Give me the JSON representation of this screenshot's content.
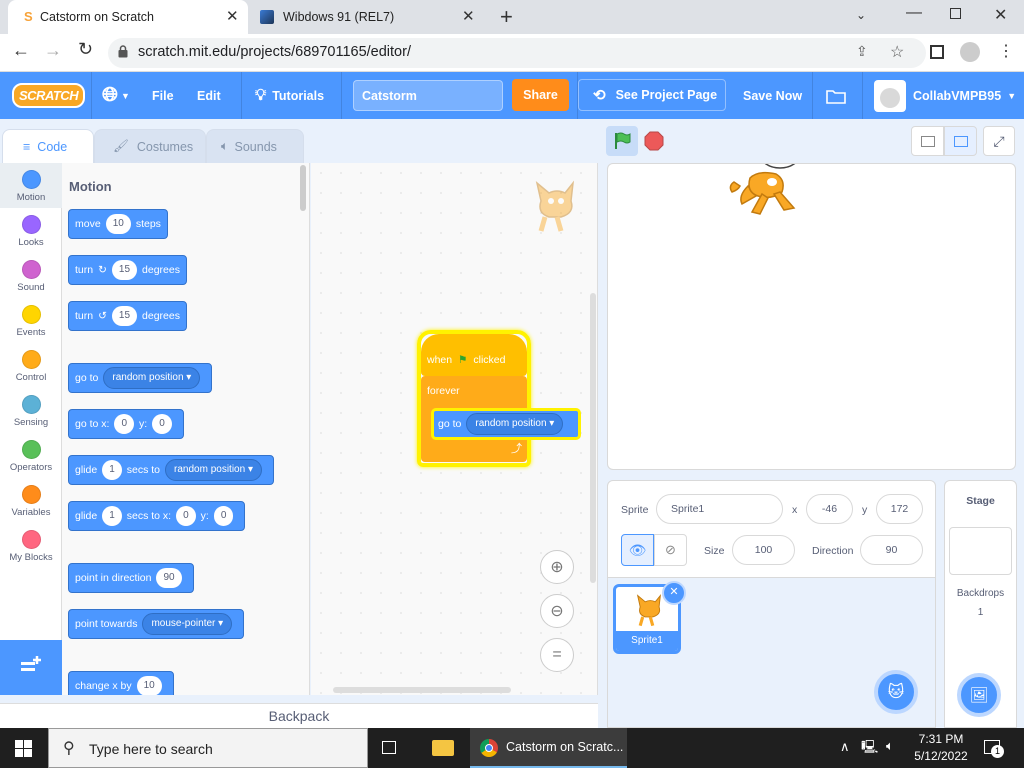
{
  "browser": {
    "tabs": [
      {
        "title": "Catstorm on Scratch",
        "active": true
      },
      {
        "title": "Wibdows 91 (REL7)",
        "active": false
      }
    ],
    "url": "scratch.mit.edu/projects/689701165/editor/"
  },
  "menubar": {
    "logo": "SCRATCH",
    "file": "File",
    "edit": "Edit",
    "tutorials": "Tutorials",
    "project_title": "Catstorm",
    "share": "Share",
    "see_project_page": "See Project Page",
    "save_now": "Save Now",
    "username": "CollabVMPB95"
  },
  "editor_tabs": {
    "code": "Code",
    "costumes": "Costumes",
    "sounds": "Sounds"
  },
  "categories": [
    {
      "label": "Motion",
      "color": "#4c97ff"
    },
    {
      "label": "Looks",
      "color": "#9966ff"
    },
    {
      "label": "Sound",
      "color": "#cf63cf"
    },
    {
      "label": "Events",
      "color": "#ffd500"
    },
    {
      "label": "Control",
      "color": "#ffab19"
    },
    {
      "label": "Sensing",
      "color": "#5cb1d6"
    },
    {
      "label": "Operators",
      "color": "#59c059"
    },
    {
      "label": "Variables",
      "color": "#ff8c1a"
    },
    {
      "label": "My Blocks",
      "color": "#ff6680"
    }
  ],
  "palette": {
    "heading": "Motion",
    "move": {
      "a": "move",
      "v": "10",
      "b": "steps"
    },
    "turn_right": {
      "a": "turn",
      "v": "15",
      "b": "degrees"
    },
    "turn_left": {
      "a": "turn",
      "v": "15",
      "b": "degrees"
    },
    "go_to": {
      "a": "go to",
      "dd": "random position"
    },
    "go_to_xy": {
      "a": "go to x:",
      "x": "0",
      "b": "y:",
      "y": "0"
    },
    "glide_to": {
      "a": "glide",
      "v": "1",
      "b": "secs to",
      "dd": "random position"
    },
    "glide_xy": {
      "a": "glide",
      "v": "1",
      "b": "secs to x:",
      "x": "0",
      "c": "y:",
      "y": "0"
    },
    "point_dir": {
      "a": "point in direction",
      "v": "90"
    },
    "point_towards": {
      "a": "point towards",
      "dd": "mouse-pointer"
    },
    "change_x": {
      "a": "change x by",
      "v": "10"
    }
  },
  "script": {
    "hat_a": "when",
    "hat_b": "clicked",
    "forever": "forever",
    "goto_a": "go to",
    "goto_dd": "random position"
  },
  "backpack": "Backpack",
  "sprite_info": {
    "sprite_label": "Sprite",
    "sprite_name": "Sprite1",
    "x_label": "x",
    "x": "-46",
    "y_label": "y",
    "y": "172",
    "size_label": "Size",
    "size": "100",
    "direction_label": "Direction",
    "direction": "90"
  },
  "sprite_list": [
    {
      "name": "Sprite1"
    }
  ],
  "stage_panel": {
    "title": "Stage",
    "backdrops_label": "Backdrops",
    "backdrops_count": "1"
  },
  "taskbar": {
    "search_placeholder": "Type here to search",
    "active_app": "Catstorm on Scratc...",
    "time": "7:31 PM",
    "date": "5/12/2022",
    "notifications": "1"
  }
}
